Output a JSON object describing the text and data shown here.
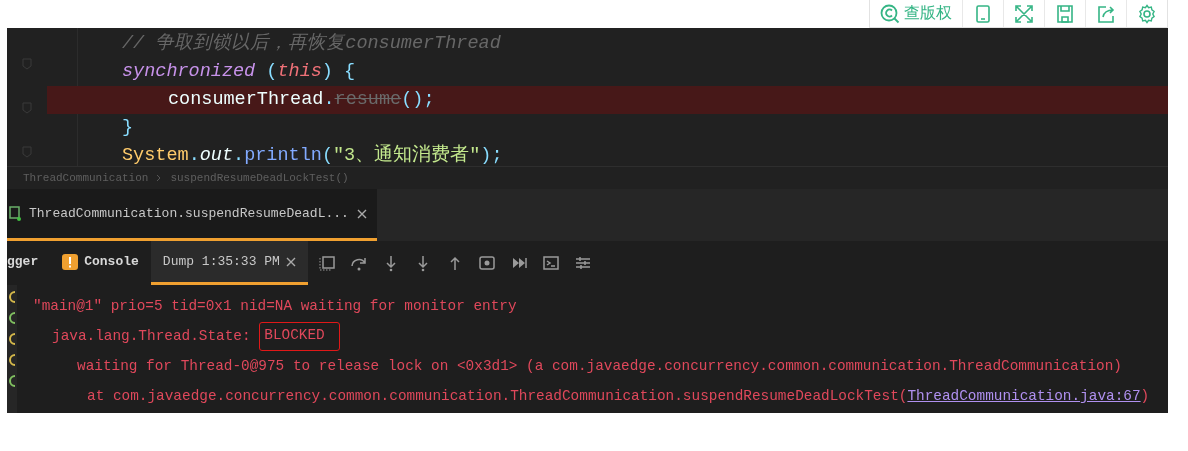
{
  "page_toolbar": {
    "copyright_button": "查版权"
  },
  "editor": {
    "lines": [
      {
        "tokens": [
          {
            "kind": "comment",
            "text": "// 争取到锁以后，再恢复consumerThread"
          }
        ]
      },
      {
        "tokens": [
          {
            "kind": "keyword",
            "text": "synchronized "
          },
          {
            "kind": "punct",
            "text": "("
          },
          {
            "kind": "this",
            "text": "this"
          },
          {
            "kind": "punct",
            "text": ") {"
          }
        ],
        "children": [
          {
            "highlighted": true,
            "tokens": [
              {
                "kind": "plain",
                "text": "consumerThread"
              },
              {
                "kind": "punct",
                "text": "."
              },
              {
                "kind": "deprecated",
                "text": "resume"
              },
              {
                "kind": "punct",
                "text": "();"
              }
            ]
          }
        ]
      },
      {
        "tokens": [
          {
            "kind": "punct",
            "text": "}"
          }
        ]
      },
      {
        "tokens": [
          {
            "kind": "class",
            "text": "System"
          },
          {
            "kind": "punct",
            "text": "."
          },
          {
            "kind": "field",
            "text": "out"
          },
          {
            "kind": "punct",
            "text": "."
          },
          {
            "kind": "method",
            "text": "println"
          },
          {
            "kind": "punct",
            "text": "("
          },
          {
            "kind": "string",
            "text": "\"3、通知消费者\""
          },
          {
            "kind": "punct",
            "text": ");"
          }
        ]
      }
    ],
    "breadcrumb": [
      "ThreadCommunication",
      "suspendResumeDeadLockTest()"
    ]
  },
  "run_tab": {
    "label": "ThreadCommunication.suspendResumeDeadL...",
    "selected": true
  },
  "debug_tabs": [
    {
      "label": "gger",
      "selected": false,
      "kind": "plain"
    },
    {
      "label": "Console",
      "selected": false,
      "kind": "warning"
    },
    {
      "label": "Dump 1:35:33 PM",
      "selected": true,
      "kind": "closable"
    }
  ],
  "console_lines": [
    {
      "kind": "header",
      "tokens": [
        {
          "kind": "text",
          "text": "\"main@1\" prio=5 tid=0x1 nid=NA waiting for monitor entry"
        }
      ]
    },
    {
      "kind": "state",
      "tokens": [
        {
          "kind": "text",
          "text": "java.lang.Thread.State: "
        },
        {
          "kind": "boxed",
          "text": "BLOCKED"
        }
      ]
    },
    {
      "kind": "waiting",
      "tokens": [
        {
          "kind": "text",
          "text": "waiting for Thread-0@975 to release lock on <0x3d1> (a com.javaedge.concurrency.common.communication.ThreadCommunication)"
        }
      ]
    },
    {
      "kind": "frame",
      "tokens": [
        {
          "kind": "text",
          "text": "at com.javaedge.concurrency.common.communication.ThreadCommunication.suspendResumeDeadLockTest("
        },
        {
          "kind": "link",
          "text": "ThreadCommunication.java:67"
        },
        {
          "kind": "text",
          "text": ")"
        }
      ]
    }
  ]
}
